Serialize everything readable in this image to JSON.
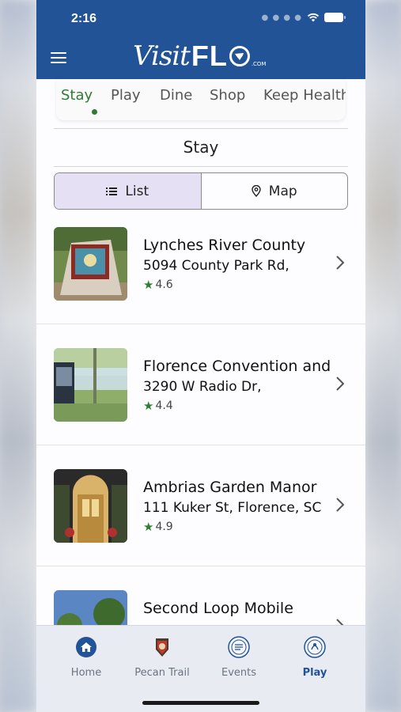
{
  "status": {
    "time": "2:16"
  },
  "header": {
    "logo_visit": "Visit",
    "logo_flo": "FL",
    "logo_com": ".COM"
  },
  "category_tabs": [
    {
      "label": "Stay",
      "active": true
    },
    {
      "label": "Play",
      "active": false
    },
    {
      "label": "Dine",
      "active": false
    },
    {
      "label": "Shop",
      "active": false
    },
    {
      "label": "Keep Healthy",
      "active": false
    }
  ],
  "section": {
    "title": "Stay"
  },
  "view_toggle": {
    "list_label": "List",
    "map_label": "Map",
    "selected": "List"
  },
  "listings": [
    {
      "name": "Lynches River County",
      "address": "5094 County Park Rd,",
      "rating": "4.6"
    },
    {
      "name": "Florence Convention and",
      "address": "3290 W Radio Dr,",
      "rating": "4.4"
    },
    {
      "name": "Ambrias Garden Manor",
      "address": "111 Kuker St, Florence, SC",
      "rating": "4.9"
    },
    {
      "name": "Second Loop Mobile",
      "address": "",
      "rating": ""
    }
  ],
  "bottom_nav": [
    {
      "label": "Home",
      "icon": "home-icon",
      "active": false
    },
    {
      "label": "Pecan Trail",
      "icon": "pecan-trail-icon",
      "active": false
    },
    {
      "label": "Events",
      "icon": "events-icon",
      "active": false
    },
    {
      "label": "Play",
      "icon": "play-icon",
      "active": true
    }
  ],
  "colors": {
    "header_blue": "#215396",
    "accent_green": "#2e7d32",
    "toggle_selected": "#e5e0f3"
  }
}
